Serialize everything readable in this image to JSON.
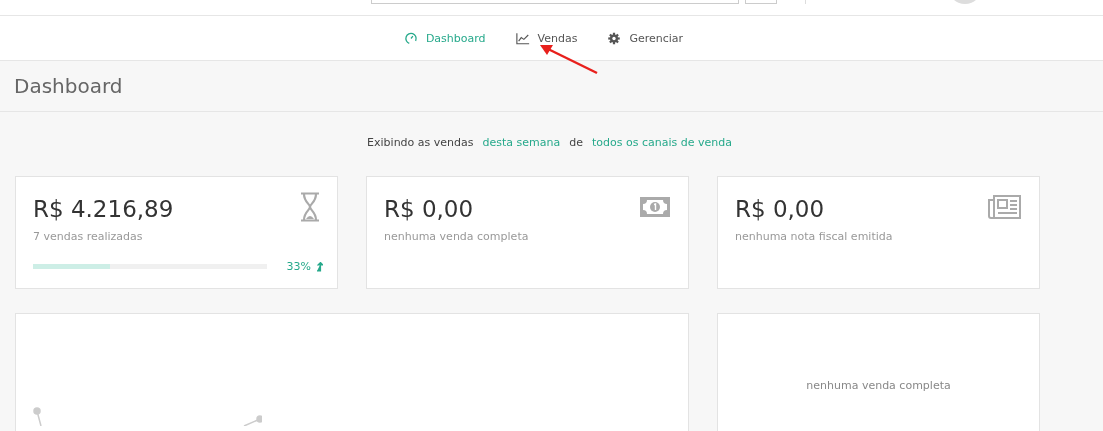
{
  "nav": {
    "items": [
      {
        "label": "Dashboard",
        "selected": true
      },
      {
        "label": "Vendas",
        "selected": false
      },
      {
        "label": "Gerenciar",
        "selected": false
      }
    ]
  },
  "page_title": "Dashboard",
  "filter": {
    "prefix": "Exibindo as vendas",
    "period": "desta semana",
    "connector": "de",
    "channel": "todos os canais de venda"
  },
  "cards": [
    {
      "value": "R$ 4.216,89",
      "caption": "7 vendas realizadas",
      "progress": {
        "level": 0.33,
        "reading": "33%"
      }
    },
    {
      "value": "R$ 0,00",
      "caption": "nenhuma venda completa"
    },
    {
      "value": "R$ 0,00",
      "caption": "nenhuma nota fiscal emitida"
    }
  ],
  "side_panel": {
    "message": "nenhuma venda completa"
  }
}
